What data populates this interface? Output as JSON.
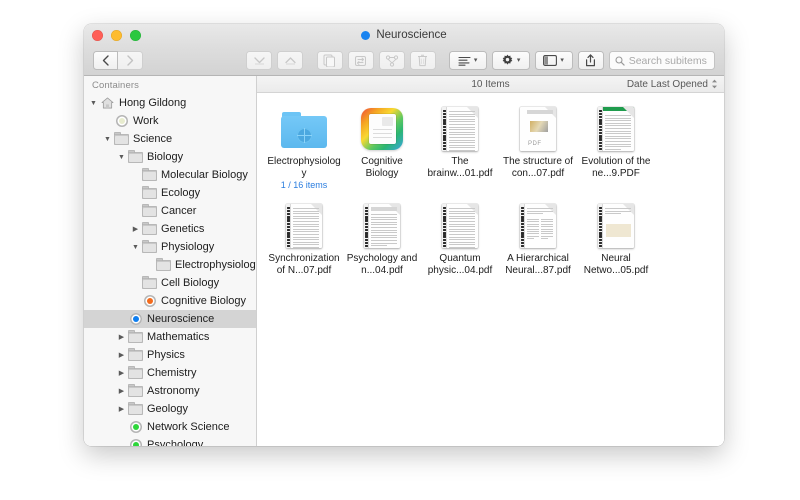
{
  "window": {
    "title": "Neuroscience",
    "title_dot_color": "#1a84f0",
    "traffic": {
      "close": "close-button",
      "minimize": "minimize-button",
      "maximize": "maximize-button"
    }
  },
  "toolbar": {
    "back_label": "‹",
    "forward_label": "›",
    "down_label": "⌄",
    "up_label": "⌃",
    "duplicate_label": "⧉",
    "refresh_label": "↻",
    "share_nodes_label": "⚭",
    "trash_label": "⌧",
    "arrange_label": "≡",
    "gear_label": "⚙",
    "view_label": "▤",
    "export_label": "⇧",
    "chevron": "▾"
  },
  "search": {
    "placeholder": "Search subitems",
    "value": "",
    "icon": "search-icon"
  },
  "sidebar": {
    "header": "Containers",
    "items": [
      {
        "label": "Hong Gildong",
        "level": 0,
        "twisty": "▼",
        "icon": "house",
        "selected": false
      },
      {
        "label": "Work",
        "level": 1,
        "twisty": "",
        "icon": "dot-gray",
        "selected": false
      },
      {
        "label": "Science",
        "level": 1,
        "twisty": "▼",
        "icon": "folder",
        "selected": false
      },
      {
        "label": "Biology",
        "level": 2,
        "twisty": "▼",
        "icon": "folder",
        "selected": false
      },
      {
        "label": "Molecular Biology",
        "level": 3,
        "twisty": "",
        "icon": "folder",
        "selected": false
      },
      {
        "label": "Ecology",
        "level": 3,
        "twisty": "",
        "icon": "folder",
        "selected": false
      },
      {
        "label": "Cancer",
        "level": 3,
        "twisty": "",
        "icon": "folder",
        "selected": false
      },
      {
        "label": "Genetics",
        "level": 3,
        "twisty": "▶",
        "icon": "folder",
        "selected": false
      },
      {
        "label": "Physiology",
        "level": 3,
        "twisty": "▼",
        "icon": "folder",
        "selected": false
      },
      {
        "label": "Electrophysiology",
        "level": 4,
        "twisty": "",
        "icon": "folder",
        "selected": false
      },
      {
        "label": "Cell Biology",
        "level": 3,
        "twisty": "",
        "icon": "folder",
        "selected": false
      },
      {
        "label": "Cognitive Biology",
        "level": 3,
        "twisty": "",
        "icon": "dot-orange",
        "selected": false
      },
      {
        "label": "Neuroscience",
        "level": 2,
        "twisty": "",
        "icon": "dot-blue",
        "selected": true
      },
      {
        "label": "Mathematics",
        "level": 2,
        "twisty": "▶",
        "icon": "folder",
        "selected": false
      },
      {
        "label": "Physics",
        "level": 2,
        "twisty": "▶",
        "icon": "folder",
        "selected": false
      },
      {
        "label": "Chemistry",
        "level": 2,
        "twisty": "▶",
        "icon": "folder",
        "selected": false
      },
      {
        "label": "Astronomy",
        "level": 2,
        "twisty": "▶",
        "icon": "folder",
        "selected": false
      },
      {
        "label": "Geology",
        "level": 2,
        "twisty": "▶",
        "icon": "folder",
        "selected": false
      },
      {
        "label": "Network Science",
        "level": 2,
        "twisty": "",
        "icon": "dot-green",
        "selected": false
      },
      {
        "label": "Psychology",
        "level": 2,
        "twisty": "",
        "icon": "dot-green",
        "selected": false
      }
    ]
  },
  "content": {
    "item_count": "10 Items",
    "sort_label": "Date Last Opened",
    "files": [
      {
        "label": "Electrophysiology",
        "sub": "1 / 16 items",
        "kind": "blue-folder"
      },
      {
        "label": "Cognitive Biology",
        "sub": "",
        "kind": "app-icon"
      },
      {
        "label": "The brainw...01.pdf",
        "sub": "",
        "kind": "doc-text"
      },
      {
        "label": "The structure of con...07.pdf",
        "sub": "",
        "kind": "doc-pdf-badge"
      },
      {
        "label": "Evolution of the ne...9.PDF",
        "sub": "",
        "kind": "doc-green-header"
      },
      {
        "label": "Synchronization of N...07.pdf",
        "sub": "",
        "kind": "doc-text"
      },
      {
        "label": "Psychology and n...04.pdf",
        "sub": "",
        "kind": "doc-title-band"
      },
      {
        "label": "Quantum physic...04.pdf",
        "sub": "",
        "kind": "doc-text"
      },
      {
        "label": "A Hierarchical Neural...87.pdf",
        "sub": "",
        "kind": "doc-twocol"
      },
      {
        "label": "Neural Netwo...05.pdf",
        "sub": "",
        "kind": "doc-cream"
      }
    ]
  }
}
